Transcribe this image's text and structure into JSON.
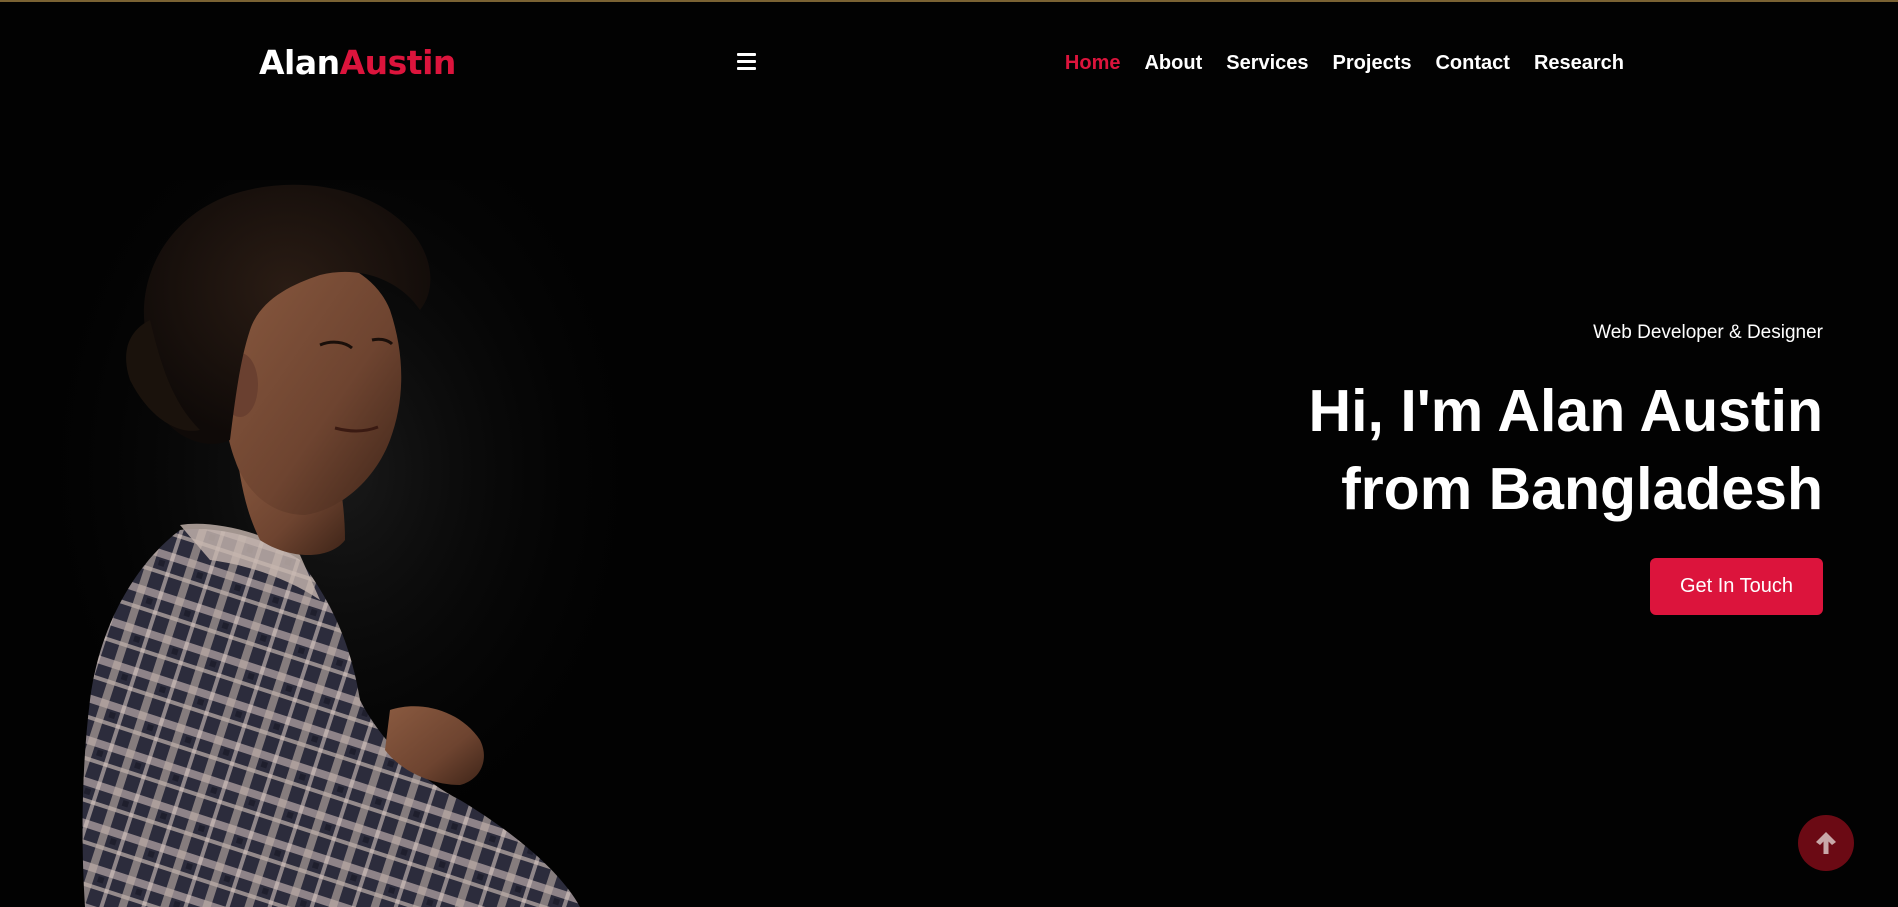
{
  "brand": {
    "first": "Alan",
    "last": "Austin"
  },
  "nav": {
    "items": [
      {
        "label": "Home",
        "active": true
      },
      {
        "label": "About",
        "active": false
      },
      {
        "label": "Services",
        "active": false
      },
      {
        "label": "Projects",
        "active": false
      },
      {
        "label": "Contact",
        "active": false
      },
      {
        "label": "Research",
        "active": false
      }
    ]
  },
  "hero": {
    "subtitle": "Web Developer & Designer",
    "title_line1": "Hi, I'm Alan Austin",
    "title_line2": "from Bangladesh",
    "cta_label": "Get In Touch"
  },
  "icons": {
    "menu": "hamburger-icon",
    "scroll_top": "arrow-up-icon"
  },
  "colors": {
    "accent": "#dc143c",
    "background": "#020202",
    "scroll_button": "#6b0a14"
  }
}
